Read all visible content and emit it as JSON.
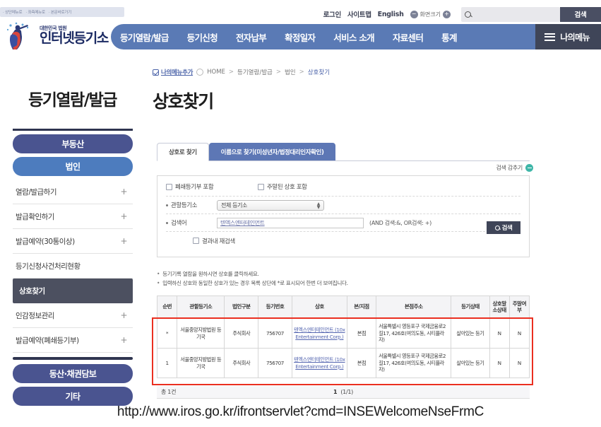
{
  "skipnav": [
    "· 상단메뉴로",
    "· 좌측메뉴로",
    "· 본문바로가기"
  ],
  "utility": {
    "login": "로그인",
    "sitemap": "사이트맵",
    "english": "English",
    "zoom_label": "화면크기",
    "zoom_minus": "−",
    "zoom_plus": "+",
    "search_placeholder": "",
    "search_value": "",
    "search_button": "검색"
  },
  "logo": {
    "sub": "대한민국 법원",
    "main": "인터넷등기소"
  },
  "gnb": {
    "items": [
      "등기열람/발급",
      "등기신청",
      "전자납부",
      "확정일자",
      "서비스 소개",
      "자료센터",
      "통계"
    ],
    "my_menu": "나의메뉴"
  },
  "breadcrumb": {
    "add_label": "나의메뉴추가",
    "home": "HOME",
    "path": [
      "등기열람/발급",
      "법인",
      "상호찾기"
    ],
    "separator": ">"
  },
  "sidebar": {
    "title": "등기열람/발급",
    "cat_a": "부동산",
    "cat_b": "법인",
    "items": [
      {
        "label": "열람/발급하기",
        "expand": "+"
      },
      {
        "label": "발급확인하기",
        "expand": "+"
      },
      {
        "label": "발급예약(30통이상)",
        "expand": "+"
      },
      {
        "label": "등기신청사건처리현황",
        "expand": ""
      },
      {
        "label": "상호찾기",
        "expand": ""
      },
      {
        "label": "인감정보관리",
        "expand": "+"
      },
      {
        "label": "발급예약(폐쇄등기부)",
        "expand": "+"
      }
    ],
    "bottom": [
      "동산·채권담보",
      "기타"
    ]
  },
  "main": {
    "page_title": "상호찾기",
    "tabs": [
      {
        "label": "상호로 찾기",
        "active": true
      },
      {
        "label": "이름으로 찾기(미성년자/법정대리인자확인)",
        "active": false
      }
    ],
    "hide_search": "검색 감추기",
    "form": {
      "chk_closed": "폐쇄등기부 포함",
      "chk_weekly": "주말된 상호 포함",
      "office_label": "관할등기소",
      "office_value": "전체 등기소",
      "keyword_label": "검색어",
      "keyword_value": "텐엑스엔터테인먼트",
      "keyword_hint": "(AND 검색:&, OR검색: +)",
      "chk_research": "결과내 재검색",
      "search_button": "검색"
    },
    "notes": [
      "등기기록 열람을 원하시면 상호를 클릭하세요.",
      "입력하신 상호와 동일한 상호가 있는 경우 목록 상단에 *로 표시되어 한번 더 보여집니다."
    ],
    "table": {
      "headers": [
        "순번",
        "관할등기소",
        "법인구분",
        "등기번호",
        "상호",
        "본/지점",
        "본점주소",
        "등기상태",
        "상호말소상태",
        "주말여부"
      ],
      "rows": [
        {
          "no": "*",
          "office": "서울중앙지방법원 등기국",
          "type": "주식회사",
          "regno": "756707",
          "name": "텐엑스엔터테인먼트 (10x Entertainment Corp.)",
          "branch": "본점",
          "address": "서울특별시 영등포구 국제금융로2길17, 426호(여의도동, 시티플라자)",
          "status": "살아있는 등기",
          "cancel": "N",
          "weekly": "N"
        },
        {
          "no": "1",
          "office": "서울중앙지방법원 등기국",
          "type": "주식회사",
          "regno": "756707",
          "name": "텐엑스엔터테인먼트 (10x Entertainment Corp.)",
          "branch": "본점",
          "address": "서울특별시 영등포구 국제금융로2길17, 426호(여의도동, 시티플라자)",
          "status": "살아있는 등기",
          "cancel": "N",
          "weekly": "N"
        }
      ],
      "total": "총 1건",
      "page_num": "1",
      "page_info": "(1/1)"
    }
  },
  "caption": {
    "url": "http://www.iros.go.kr/ifrontservlet?cmd=INSEWelcomeNseFrmC"
  },
  "colors": {
    "nav": "#5a7ab5",
    "accent": "#4a5490",
    "highlight": "#ea2f20",
    "link": "#5566b0"
  }
}
